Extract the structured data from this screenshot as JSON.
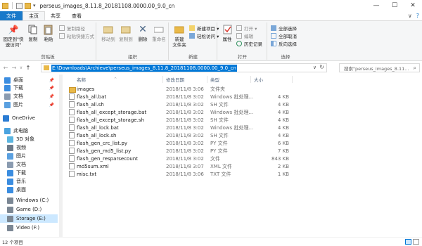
{
  "window": {
    "title": "perseus_images_8.11.8_20181108.0000.00_9.0_cn",
    "minimize": "—",
    "maximize": "☐",
    "close": "✕"
  },
  "menu": {
    "tabs": [
      {
        "label": "文件"
      },
      {
        "label": "主页"
      },
      {
        "label": "共享"
      },
      {
        "label": "查看"
      }
    ],
    "expand_icon": "∨",
    "help_icon": "?"
  },
  "ribbon": {
    "clipboard": {
      "label": "剪贴板",
      "pin_label": "固定到\"快\n速访问\"",
      "copy_label": "复制",
      "paste_label": "粘贴",
      "copy_path_label": "复制路径",
      "paste_shortcut_label": "粘贴快捷方式",
      "cut_label": "剪切"
    },
    "organize": {
      "label": "组织",
      "move_to_label": "移动到",
      "copy_to_label": "复制到",
      "delete_label": "删除",
      "rename_label": "重命名"
    },
    "new": {
      "label": "新建",
      "new_folder_label": "新建\n文件夹",
      "new_item_label": "新建项目 ▾",
      "easy_access_label": "轻松访问 ▾"
    },
    "open": {
      "label": "打开",
      "properties_label": "属性",
      "open_label": "打开 ▾",
      "edit_label": "编辑",
      "history_label": "历史记录"
    },
    "select": {
      "label": "选择",
      "select_all_label": "全部选择",
      "select_none_label": "全部取消",
      "invert_label": "反向选择"
    }
  },
  "address": {
    "path": "E:\\Downloads\\Archieve\\perseus_images_8.11.8_20181108.0000.00_9.0_cn",
    "search_placeholder": "搜索\"perseus_images_8.11...",
    "back": "←",
    "forward": "→",
    "up": "↑",
    "recent": "∨"
  },
  "nav": {
    "items": [
      {
        "label": "桌面",
        "icon": "desktop-icon",
        "color": "#3b8de0",
        "pinned": true
      },
      {
        "label": "下载",
        "icon": "download-icon",
        "color": "#3b8de0",
        "pinned": true
      },
      {
        "label": "文档",
        "icon": "documents-icon",
        "color": "#8a9bb0",
        "pinned": true
      },
      {
        "label": "图片",
        "icon": "pictures-icon",
        "color": "#5aa0e0",
        "pinned": true
      },
      {
        "label": "OneDrive",
        "icon": "onedrive-icon",
        "color": "#2b7cd3",
        "pinned": false
      },
      {
        "label": "此电脑",
        "icon": "computer-icon",
        "color": "#4aa3df",
        "pinned": false
      },
      {
        "label": "3D 对象",
        "icon": "3d-objects-icon",
        "color": "#5bb5e0",
        "pinned": false
      },
      {
        "label": "视频",
        "icon": "videos-icon",
        "color": "#6c7a89",
        "pinned": false
      },
      {
        "label": "图片",
        "icon": "pictures-icon",
        "color": "#5aa0e0",
        "pinned": false
      },
      {
        "label": "文档",
        "icon": "documents-icon",
        "color": "#8a9bb0",
        "pinned": false
      },
      {
        "label": "下载",
        "icon": "download-icon",
        "color": "#3b8de0",
        "pinned": false
      },
      {
        "label": "音乐",
        "icon": "music-icon",
        "color": "#3b8de0",
        "pinned": false
      },
      {
        "label": "桌面",
        "icon": "desktop-icon",
        "color": "#3b8de0",
        "pinned": false
      },
      {
        "label": "Windows (C:)",
        "icon": "drive-icon",
        "color": "#7b8794",
        "pinned": false
      },
      {
        "label": "Game (D:)",
        "icon": "drive-icon",
        "color": "#7b8794",
        "pinned": false
      },
      {
        "label": "Storage (E:)",
        "icon": "drive-icon",
        "color": "#7b8794",
        "pinned": false,
        "selected": true
      },
      {
        "label": "Video (F:)",
        "icon": "drive-icon",
        "color": "#7b8794",
        "pinned": false
      }
    ]
  },
  "columns": {
    "name": "名称",
    "date": "修改日期",
    "type": "类型",
    "size": "大小",
    "sort_arrow": "^"
  },
  "files": [
    {
      "name": "images",
      "date": "2018/11/8 3:06",
      "type": "文件夹",
      "size": "",
      "folder": true
    },
    {
      "name": "flash_all.bat",
      "date": "2018/11/8 3:02",
      "type": "Windows 批处理...",
      "size": "4 KB"
    },
    {
      "name": "flash_all.sh",
      "date": "2018/11/8 3:02",
      "type": "SH 文件",
      "size": "4 KB"
    },
    {
      "name": "flash_all_except_storage.bat",
      "date": "2018/11/8 3:02",
      "type": "Windows 批处理...",
      "size": "4 KB"
    },
    {
      "name": "flash_all_except_storage.sh",
      "date": "2018/11/8 3:02",
      "type": "SH 文件",
      "size": "4 KB"
    },
    {
      "name": "flash_all_lock.bat",
      "date": "2018/11/8 3:02",
      "type": "Windows 批处理...",
      "size": "4 KB"
    },
    {
      "name": "flash_all_lock.sh",
      "date": "2018/11/8 3:02",
      "type": "SH 文件",
      "size": "4 KB"
    },
    {
      "name": "flash_gen_crc_list.py",
      "date": "2018/11/8 3:02",
      "type": "PY 文件",
      "size": "6 KB"
    },
    {
      "name": "flash_gen_md5_list.py",
      "date": "2018/11/8 3:02",
      "type": "PY 文件",
      "size": "7 KB"
    },
    {
      "name": "flash_gen_resparsecount",
      "date": "2018/11/8 3:02",
      "type": "文件",
      "size": "843 KB"
    },
    {
      "name": "md5sum.xml",
      "date": "2018/11/8 3:07",
      "type": "XML 文件",
      "size": "2 KB"
    },
    {
      "name": "misc.txt",
      "date": "2018/11/8 3:06",
      "type": "TXT 文件",
      "size": "1 KB"
    }
  ],
  "status": {
    "count": "12 个项目"
  }
}
